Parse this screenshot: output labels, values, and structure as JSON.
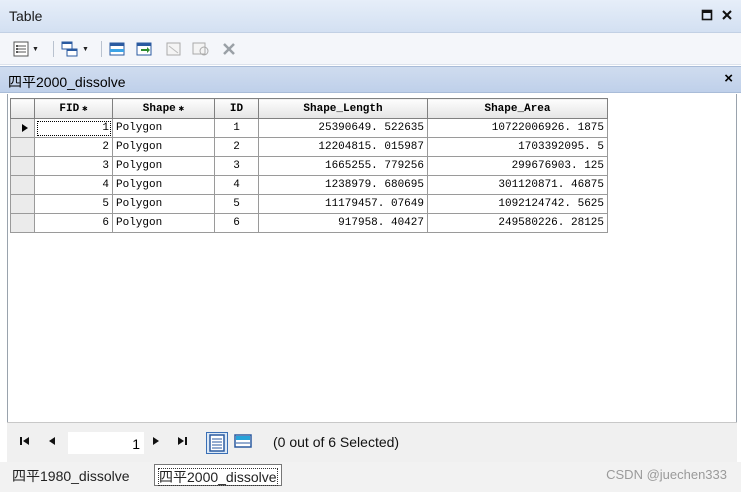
{
  "window": {
    "title": "Table"
  },
  "table_tab": {
    "name": "四平2000_dissolve"
  },
  "grid": {
    "columns": [
      "FID",
      "Shape",
      "ID",
      "Shape_Length",
      "Shape_Area"
    ],
    "rows": [
      [
        "1",
        "Polygon",
        "1",
        "25390649. 522635",
        "10722006926. 1875"
      ],
      [
        "2",
        "Polygon",
        "2",
        "12204815. 015987",
        "1703392095. 5"
      ],
      [
        "3",
        "Polygon",
        "3",
        "1665255. 779256",
        "299676903. 125"
      ],
      [
        "4",
        "Polygon",
        "4",
        "1238979. 680695",
        "301120871. 46875"
      ],
      [
        "5",
        "Polygon",
        "5",
        "11179457. 07649",
        "1092124742. 5625"
      ],
      [
        "6",
        "Polygon",
        "6",
        "917958. 40427",
        "249580226. 28125"
      ]
    ]
  },
  "nav": {
    "current_record": "1",
    "selection_text": "(0 out of 6 Selected)"
  },
  "bottom_tabs": [
    "四平1980_dissolve",
    "四平2000_dissolve"
  ],
  "watermark": "CSDN @juechen333"
}
